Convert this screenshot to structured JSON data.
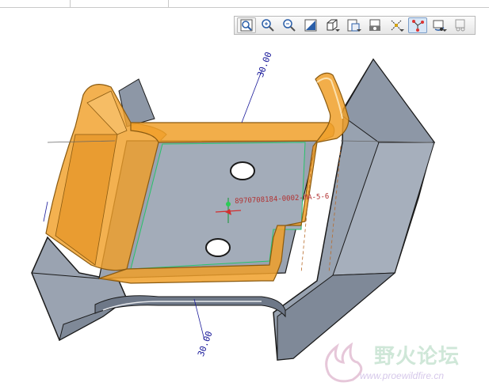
{
  "toolbar": {
    "buttons": [
      {
        "name": "refit-icon",
        "active": false
      },
      {
        "name": "zoom-in-icon",
        "active": false
      },
      {
        "name": "zoom-out-icon",
        "active": false
      },
      {
        "name": "repaint-icon",
        "active": false
      },
      {
        "name": "display-style-icon",
        "active": false,
        "dropdown": true
      },
      {
        "name": "saved-views-icon",
        "active": false,
        "dropdown": true
      },
      {
        "name": "view-manager-icon",
        "active": false
      },
      {
        "name": "datum-display-icon",
        "active": false,
        "dropdown": true
      },
      {
        "name": "annotation-display-icon",
        "active": true
      },
      {
        "name": "spin-center-icon",
        "active": false,
        "dropdown": true
      },
      {
        "name": "appearance-icon",
        "active": false
      }
    ]
  },
  "model": {
    "dimension_top": "30.00",
    "dimension_bottom": "30.00",
    "feature_label": "8970708184-0002-MA-5-6",
    "highlight_color": "#f0a02a",
    "part_color": "#98a2b0"
  },
  "watermark": {
    "text": "野火论坛",
    "url": "www.proewildfire.cn"
  }
}
